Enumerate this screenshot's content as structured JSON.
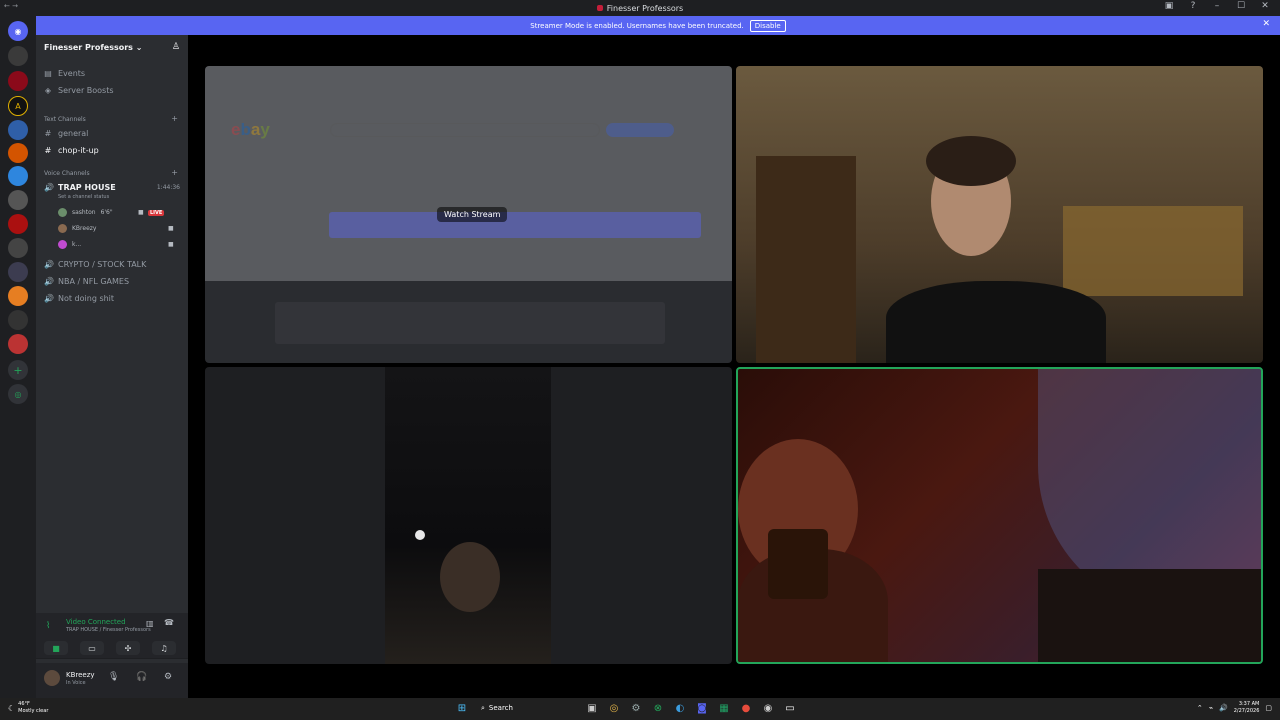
{
  "window": {
    "title": "Finesser Professors",
    "nav": "← →"
  },
  "banner": {
    "message": "Streamer Mode is enabled. Usernames have been truncated.",
    "disable_label": "Disable"
  },
  "server": {
    "name": "Finesser Professors"
  },
  "sidebar": {
    "events_label": "Events",
    "boosts_label": "Server Boosts",
    "text_category": "Text Channels",
    "text_channels": [
      {
        "name": "general"
      },
      {
        "name": "chop-it-up"
      }
    ],
    "voice_category": "Voice Channels",
    "voice_channels": [
      {
        "name": "TRAP HOUSE",
        "time": "1:44:36",
        "status_hint": "Set a channel status"
      },
      {
        "name": "CRYPTO / STOCK TALK"
      },
      {
        "name": "NBA / NFL GAMES"
      },
      {
        "name": "Not doing shit"
      }
    ],
    "voice_users": [
      {
        "name": "sashton",
        "extra": "6'6\"",
        "live": "LIVE"
      },
      {
        "name": "KBreezy"
      },
      {
        "name": "k..."
      }
    ]
  },
  "voice_panel": {
    "title": "Video Connected",
    "subtitle": "TRAP HOUSE / Finesser Professors"
  },
  "user_panel": {
    "name": "KBreezy",
    "status": "In Voice"
  },
  "stream": {
    "watch_label": "Watch Stream",
    "site_name": [
      "e",
      "b",
      "a",
      "y"
    ]
  },
  "taskbar": {
    "weather_temp": "46°F",
    "weather_desc": "Mostly clear",
    "search_label": "Search",
    "time": "3:37 AM",
    "date": "2/27/2026"
  },
  "colors": {
    "accent": "#5865f2",
    "speaking": "#23a55a",
    "live": "#da373c"
  }
}
